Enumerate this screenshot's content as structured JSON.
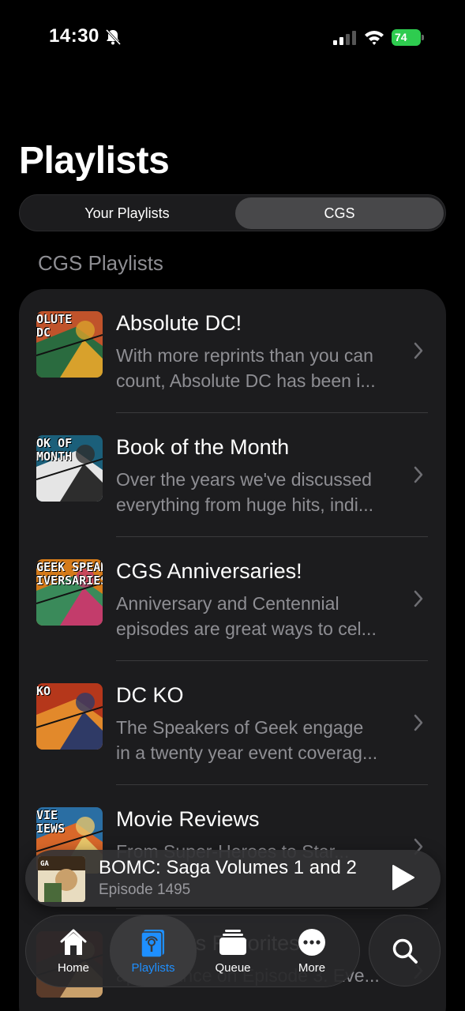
{
  "status_bar": {
    "time": "14:30",
    "battery": "74"
  },
  "page": {
    "title": "Playlists"
  },
  "segments": {
    "left": "Your Playlists",
    "right": "CGS"
  },
  "section": {
    "header": "CGS Playlists"
  },
  "playlists": [
    {
      "title": "Absolute DC!",
      "line1": "With more reprints than you can",
      "line2": "count, Absolute DC has been i...",
      "art_text": "OLUTE\nDC",
      "colors": [
        "#c0532b",
        "#2a6b3f",
        "#d8a12c"
      ]
    },
    {
      "title": "Book of the Month",
      "line1": "Over the years we've discussed",
      "line2": "everything from huge hits, indi...",
      "art_text": "OK OF\nMONTH",
      "colors": [
        "#1b5f7a",
        "#e5e5e5",
        "#2d2d2d"
      ]
    },
    {
      "title": "CGS Anniversaries!",
      "line1": "Anniversary and Centennial",
      "line2": "episodes are great ways to cel...",
      "art_text": "GEEK SPEAK\nIVERSARIES",
      "colors": [
        "#d47a1a",
        "#3a8a5a",
        "#c33c6b"
      ]
    },
    {
      "title": "DC KO",
      "line1": "The Speakers of Geek engage",
      "line2": "in a twenty year event coverag...",
      "art_text": "KO",
      "colors": [
        "#b5371b",
        "#e2892b",
        "#2f3a66"
      ]
    },
    {
      "title": "Movie Reviews",
      "line1": "From Super-Heroes to Star...",
      "line2": "",
      "art_text": "VIE\nIEWS",
      "colors": [
        "#2a6ea3",
        "#d9682a",
        "#e9c66a"
      ]
    },
    {
      "title": "Speakers Favorites",
      "line1": "",
      "line2": "appearance on Episode 3. Eve...",
      "art_text": "",
      "colors": [
        "#8b2d1f",
        "#5a3b2a",
        "#c9a06b"
      ]
    }
  ],
  "now_playing": {
    "title": "BOMC: Saga Volumes 1 and 2",
    "subtitle": "Episode 1495"
  },
  "tabs": [
    {
      "label": "Home",
      "icon": "house-icon"
    },
    {
      "label": "Playlists",
      "icon": "playlist-icon"
    },
    {
      "label": "Queue",
      "icon": "queue-icon"
    },
    {
      "label": "More",
      "icon": "ellipsis-icon"
    }
  ],
  "colors": {
    "accent": "#1e8fff",
    "battery": "#2ecc4f"
  }
}
